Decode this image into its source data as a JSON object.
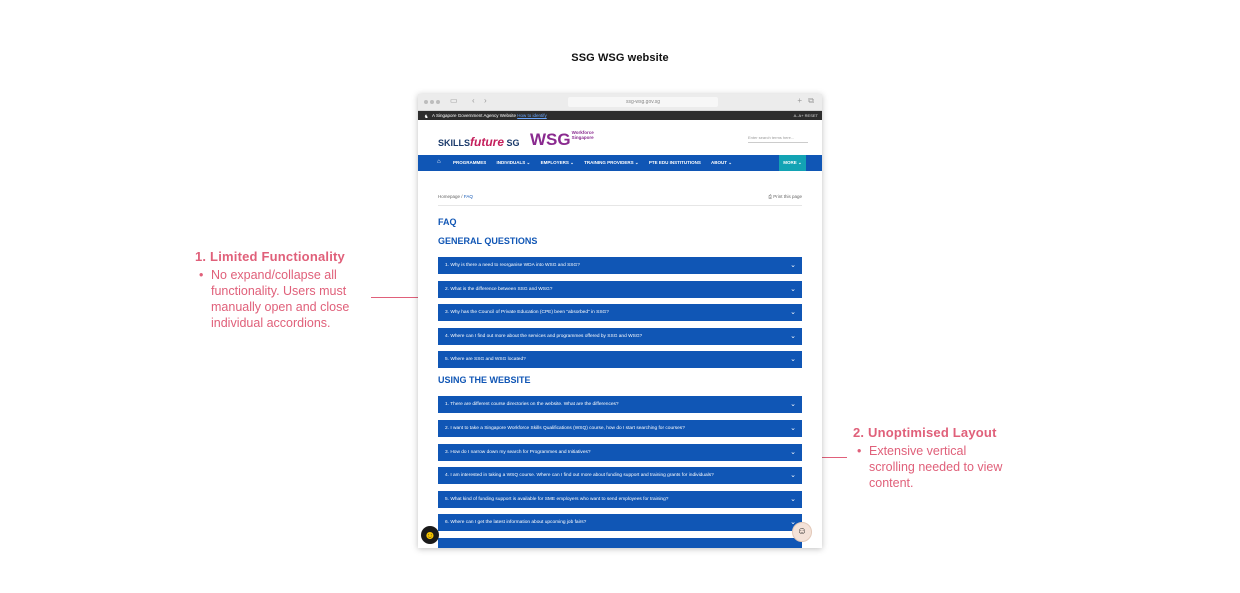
{
  "title": "SSG WSG website",
  "annotations": [
    {
      "heading": "1. Limited Functionality",
      "bullet": "No expand/collapse all functionality. Users must manually open and close individual accordions."
    },
    {
      "heading": "2. Unoptimised Layout",
      "bullet": "Extensive vertical scrolling needed to view content."
    }
  ],
  "browser": {
    "url": "ssg-wsg.gov.sg",
    "gov_banner": "A Singapore Government Agency Website",
    "gov_link": "How to identify",
    "tools": "A-   A+   RESET",
    "logo_skills": "SKILLS",
    "logo_future": "future",
    "logo_sg": "SG",
    "logo_wsg": "WSG",
    "logo_wsg_sub": "Workforce Singapore",
    "search_placeholder": "Enter search terms here...",
    "nav": [
      "PROGRAMMES",
      "INDIVIDUALS ⌄",
      "EMPLOYERS ⌄",
      "TRAINING PROVIDERS ⌄",
      "PTE EDU INSTITUTIONS",
      "ABOUT ⌄"
    ],
    "nav_more": "MORE ⌄",
    "breadcrumb_home": "Homepage",
    "breadcrumb_sep": "/",
    "breadcrumb_current": "FAQ",
    "print": "Print this page",
    "page_heading": "FAQ",
    "sections": [
      {
        "title": "GENERAL QUESTIONS",
        "items": [
          "1. Why is there a need to reorganise WDA into WSG and SSG?",
          "2. What is the difference between SSG and WSG?",
          "3. Why has the Council of Private Education (CPE) been \"absorbed\" in SSG?",
          "4. Where can I find out more about the services and programmes offered by SSG and WSG?",
          "5. Where are SSG and WSG located?"
        ]
      },
      {
        "title": "USING THE WEBSITE",
        "items": [
          "1. There are different course directories on the website. What are the differences?",
          "2. I want to take a Singapore Workforce Skills Qualifications (WSQ) course, how do I start searching for courses?",
          "3. How do I narrow down my search for Programmes and Initiatives?",
          "4. I am interested in taking a WSQ course. Where can I find out more about funding support and training grants for individuals?",
          "5. What kind of funding support is available for SME employers who want to send employees for training?",
          "6. Where can I get the latest information about upcoming job fairs?"
        ]
      }
    ]
  },
  "colors": {
    "accent": "#1056b5",
    "annotation": "#e0607a",
    "more": "#13a3b4"
  },
  "icons": [
    "home-icon",
    "chevron-down-icon",
    "printer-icon",
    "chatbot-icon",
    "assistant-avatar-icon"
  ]
}
